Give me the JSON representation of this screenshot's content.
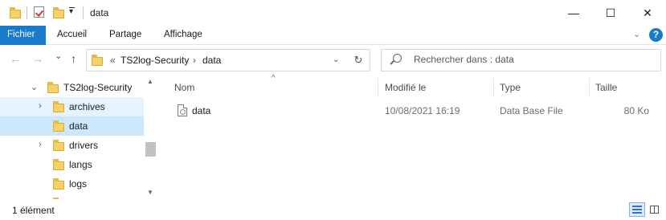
{
  "window": {
    "title": "data",
    "minimize_glyph": "—",
    "maximize_glyph": "☐",
    "close_glyph": "✕"
  },
  "ribbon": {
    "tabs": [
      {
        "label": "Fichier",
        "active": true
      },
      {
        "label": "Accueil",
        "active": false
      },
      {
        "label": "Partage",
        "active": false
      },
      {
        "label": "Affichage",
        "active": false
      }
    ],
    "help_glyph": "?",
    "expand_glyph": "⌄"
  },
  "nav": {
    "back_glyph": "←",
    "forward_glyph": "→",
    "recent_glyph": "⌄",
    "up_glyph": "↑",
    "breadcrumb": [
      "TS2log-Security",
      "data"
    ],
    "overflow_glyph": "«",
    "separator_glyph": "›",
    "refresh_glyph": "↻",
    "search_placeholder": "Rechercher dans : data"
  },
  "tree": {
    "items": [
      {
        "label": "TS2log-Security",
        "expander": "⌄",
        "state": "normal"
      },
      {
        "label": "archives",
        "expander": "›",
        "state": "hover"
      },
      {
        "label": "data",
        "expander": "",
        "state": "selected"
      },
      {
        "label": "drivers",
        "expander": "›",
        "state": "normal"
      },
      {
        "label": "langs",
        "expander": "",
        "state": "normal"
      },
      {
        "label": "logs",
        "expander": "",
        "state": "normal"
      }
    ],
    "scroll_up_glyph": "▲",
    "scroll_down_glyph": "▼"
  },
  "columns": {
    "name": "Nom",
    "modified": "Modifié le",
    "type": "Type",
    "size": "Taille",
    "sort_glyph": "^"
  },
  "files": [
    {
      "name": "data",
      "modified": "10/08/2021 16:19",
      "type": "Data Base File",
      "size": "80 Ko",
      "icon": "database-file-icon"
    }
  ],
  "status": {
    "item_count": "1 élément"
  },
  "colors": {
    "accent": "#1979ca",
    "selection": "#cce8ff",
    "hover": "#e5f3ff",
    "folder": "#f6d36a"
  }
}
